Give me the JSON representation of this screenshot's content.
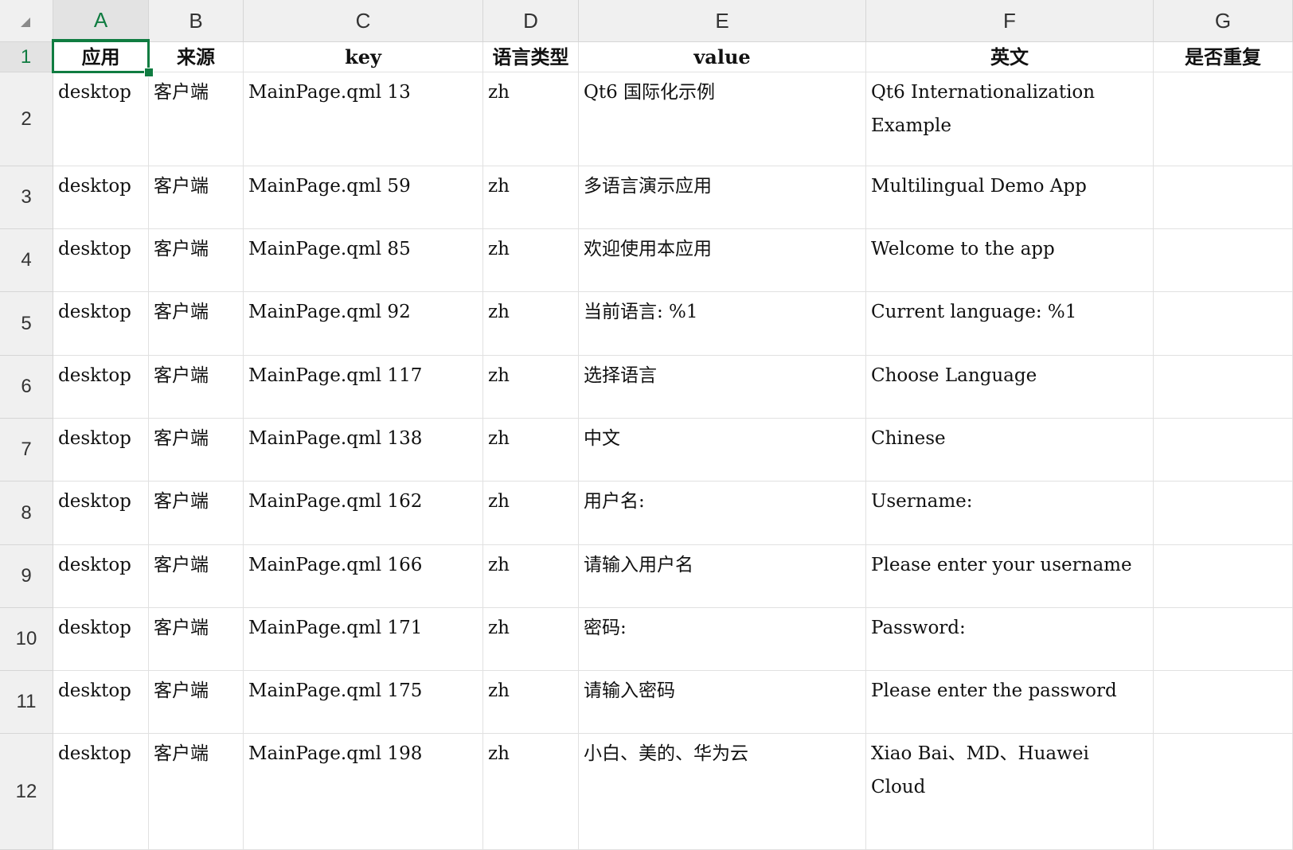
{
  "columns": [
    "A",
    "B",
    "C",
    "D",
    "E",
    "F",
    "G"
  ],
  "active_column": "A",
  "active_row": 1,
  "header_row": [
    "应用",
    "来源",
    "key",
    "语言类型",
    "value",
    "英文",
    "是否重复"
  ],
  "rows": [
    {
      "num": "2",
      "cells": [
        "desktop",
        "客户端",
        "MainPage.qml 13",
        "zh",
        "Qt6 国际化示例",
        "Qt6 Internationalization Example",
        ""
      ]
    },
    {
      "num": "3",
      "cells": [
        "desktop",
        "客户端",
        "MainPage.qml 59",
        "zh",
        "多语言演示应用",
        "Multilingual Demo App",
        ""
      ]
    },
    {
      "num": "4",
      "cells": [
        "desktop",
        "客户端",
        "MainPage.qml 85",
        "zh",
        "欢迎使用本应用",
        "Welcome to the app",
        ""
      ]
    },
    {
      "num": "5",
      "cells": [
        "desktop",
        "客户端",
        "MainPage.qml 92",
        "zh",
        "当前语言: %1",
        "Current language: %1",
        ""
      ]
    },
    {
      "num": "6",
      "cells": [
        "desktop",
        "客户端",
        "MainPage.qml 117",
        "zh",
        "选择语言",
        "Choose Language",
        ""
      ]
    },
    {
      "num": "7",
      "cells": [
        "desktop",
        "客户端",
        "MainPage.qml 138",
        "zh",
        "中文",
        "Chinese",
        ""
      ]
    },
    {
      "num": "8",
      "cells": [
        "desktop",
        "客户端",
        "MainPage.qml 162",
        "zh",
        "用户名:",
        "Username:",
        ""
      ]
    },
    {
      "num": "9",
      "cells": [
        "desktop",
        "客户端",
        "MainPage.qml 166",
        "zh",
        "请输入用户名",
        "Please enter your username",
        ""
      ]
    },
    {
      "num": "10",
      "cells": [
        "desktop",
        "客户端",
        "MainPage.qml 171",
        "zh",
        "密码:",
        "Password:",
        ""
      ]
    },
    {
      "num": "11",
      "cells": [
        "desktop",
        "客户端",
        "MainPage.qml 175",
        "zh",
        "请输入密码",
        "Please enter the password",
        ""
      ]
    },
    {
      "num": "12",
      "cells": [
        "desktop",
        "客户端",
        "MainPage.qml 198",
        "zh",
        "小白、美的、华为云",
        "Xiao Bai、MD、Huawei Cloud",
        ""
      ]
    }
  ],
  "icons": {
    "select_all": "select-all-triangle-icon"
  },
  "colors": {
    "accent": "#107c41",
    "header_bg": "#f0f0f0",
    "grid": "#e1e1e1"
  }
}
